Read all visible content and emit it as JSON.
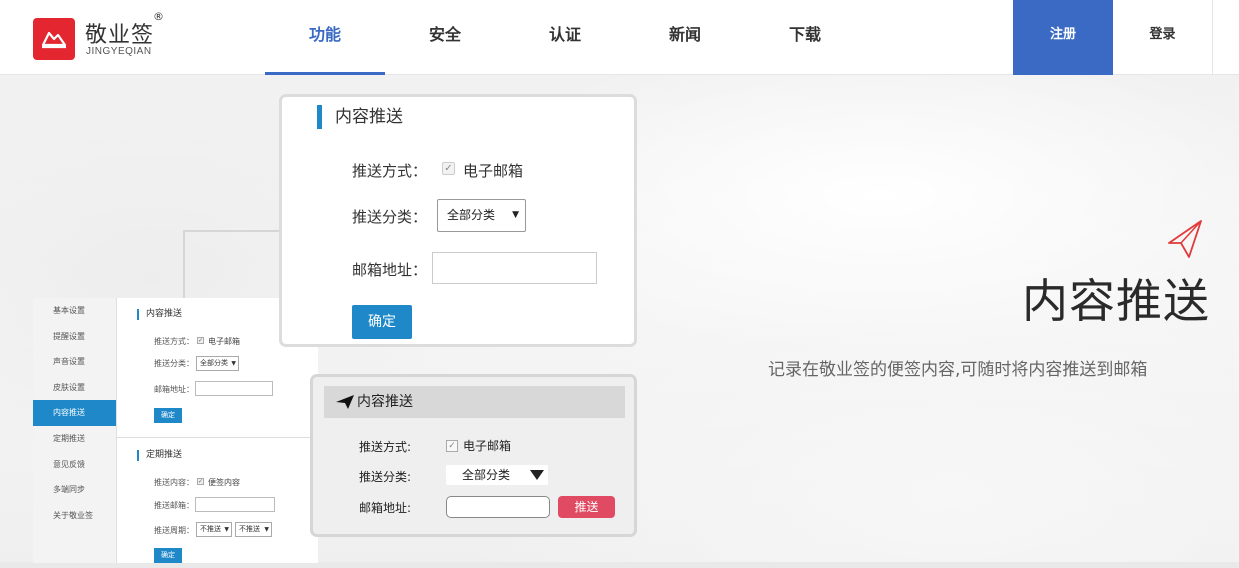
{
  "header": {
    "logo_name": "敬业签",
    "logo_reg": "®",
    "logo_sub": "JINGYEQIAN",
    "nav": [
      "功能",
      "安全",
      "认证",
      "新闻",
      "下载"
    ],
    "active_nav": "功能",
    "register": "注册",
    "login": "登录"
  },
  "colors": {
    "accent": "#3a6ac4",
    "brand_red": "#e3262f",
    "button_blue": "#1e88c8",
    "push_red": "#e04a63"
  },
  "mini": {
    "sidebar": [
      "基本设置",
      "提醒设置",
      "声音设置",
      "皮肤设置",
      "内容推送",
      "定期推送",
      "意见反馈",
      "多端同步",
      "关于敬业签"
    ],
    "active_index": 4,
    "push": {
      "title": "内容推送",
      "method_label": "推送方式：",
      "method_value": "电子邮箱",
      "category_label": "推送分类：",
      "category_value": "全部分类",
      "email_label": "邮箱地址：",
      "confirm": "确定"
    },
    "periodic": {
      "title": "定期推送",
      "content_label": "推送内容：",
      "content_value": "便签内容",
      "email_label": "推送邮箱：",
      "period_label": "推送周期：",
      "period_value_1": "不推送",
      "period_value_2": "不推送",
      "confirm": "确定"
    }
  },
  "card": {
    "title": "内容推送",
    "method_label": "推送方式：",
    "method_value": "电子邮箱",
    "category_label": "推送分类：",
    "category_value": "全部分类",
    "email_label": "邮箱地址：",
    "email_value": "",
    "confirm": "确定"
  },
  "card2": {
    "title": "内容推送",
    "method_label": "推送方式:",
    "method_value": "电子邮箱",
    "category_label": "推送分类:",
    "category_value": "全部分类",
    "email_label": "邮箱地址:",
    "push_button": "推送"
  },
  "hero": {
    "title": "内容推送",
    "description": "记录在敬业签的便签内容,可随时将内容推送到邮箱"
  }
}
